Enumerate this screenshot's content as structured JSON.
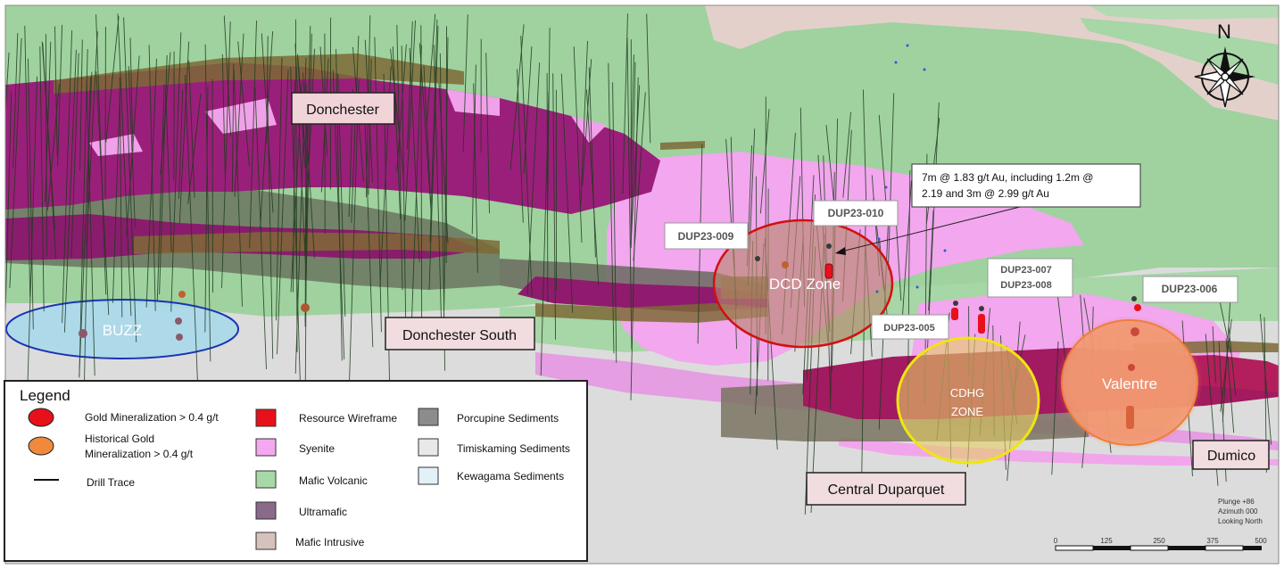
{
  "labels": {
    "donchester": "Donchester",
    "donchester_south": "Donchester South",
    "buzz": "BUZZ",
    "dcd_zone": "DCD Zone",
    "cdhg_line1": "CDHG",
    "cdhg_line2": "ZONE",
    "valentre": "Valentre",
    "central_duparquet": "Central Duparquet",
    "dumico": "Dumico"
  },
  "holes": {
    "dup23_009": "DUP23-009",
    "dup23_010": "DUP23-010",
    "dup23_007": "DUP23-007",
    "dup23_008": "DUP23-008",
    "dup23_005": "DUP23-005",
    "dup23_006": "DUP23-006"
  },
  "callout": {
    "line1": "7m @ 1.83 g/t Au, including 1.2m @",
    "line2": "2.19 and 3m @ 2.99 g/t Au"
  },
  "north_arrow": {
    "letter": "N",
    "icon": "compass-rose-icon"
  },
  "view_info": {
    "plunge": "Plunge +86",
    "azimuth": "Azimuth 000",
    "looking": "Looking North"
  },
  "scale_bar": {
    "ticks": [
      "0",
      "125",
      "250",
      "375",
      "500"
    ]
  },
  "legend": {
    "title": "Legend",
    "items": {
      "gold": "Gold Mineralization > 0.4 g/t",
      "hist_line1": "Historical Gold",
      "hist_line2": "Mineralization > 0.4 g/t",
      "drill": "Drill Trace",
      "resource": "Resource Wireframe",
      "syenite": "Syenite",
      "mafic_volcanic": "Mafic Volcanic",
      "ultramafic": "Ultramafic",
      "mafic_intrusive": "Mafic Intrusive",
      "porcupine": "Porcupine Sediments",
      "timiskaming": "Timiskaming Sediments",
      "kewagama": "Kewagama Sediments"
    }
  },
  "colors": {
    "gold_mineralization": "#e8101a",
    "historical_gold": "#ef8a3c",
    "resource_wireframe": "#e8101a",
    "syenite": "#f4a8f0",
    "mafic_volcanic": "#a8d8a8",
    "ultramafic": "#8a6a88",
    "mafic_intrusive": "#d6c2bc",
    "porcupine_sediments": "#8c8c8c",
    "timiskaming_sediments": "#e8e8e8",
    "kewagama_sediments": "#e2f1f7",
    "buzz_zone": "#1a33b3",
    "dcd_zone": "#d21010",
    "cdhg_zone": "#f0e610",
    "valentre_zone": "#ee7f3b"
  }
}
